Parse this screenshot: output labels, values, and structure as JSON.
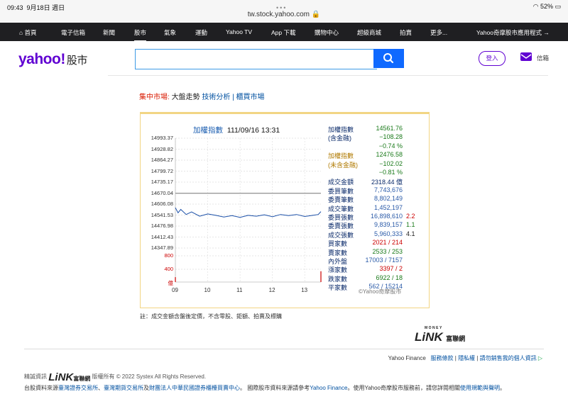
{
  "status_bar": {
    "time": "09:43",
    "date": "9月18日 週日",
    "url": "tw.stock.yahoo.com",
    "battery": "52%"
  },
  "top_nav": [
    "首頁",
    "電子信箱",
    "新聞",
    "股市",
    "氣象",
    "運動",
    "Yahoo TV",
    "App 下載",
    "購物中心",
    "超級商城",
    "拍賣",
    "更多..."
  ],
  "top_nav_app": "Yahoo奇摩股市應用程式",
  "header": {
    "logo": "yahoo!",
    "logo_suffix": "股市",
    "login": "登入",
    "mail": "信箱",
    "search_value": ""
  },
  "breadcrumb": {
    "label": "集中市場:",
    "current": "大盤走勢",
    "link1": "技術分析",
    "sep": "|",
    "link2": "櫃買市場"
  },
  "chart_data": {
    "type": "line",
    "title": "加權指數",
    "timestamp": "111/09/16 13:31",
    "y_ticks": [
      "14993.37",
      "14928.82",
      "14864.27",
      "14799.72",
      "14735.17",
      "14670.04",
      "14606.08",
      "14541.53",
      "14476.98",
      "14412.43",
      "14347.89"
    ],
    "volume_ticks": [
      "800",
      "400",
      "億"
    ],
    "x_ticks": [
      "09",
      "10",
      "11",
      "12",
      "13"
    ],
    "ylim": [
      14347.89,
      14993.37
    ],
    "reference_line": 14670.04,
    "series": [
      {
        "x": [
          "09:00",
          "09:05",
          "09:10",
          "09:20",
          "09:30",
          "09:45",
          "10:00",
          "10:15",
          "10:30",
          "10:45",
          "11:00",
          "11:15",
          "11:30",
          "11:45",
          "12:00",
          "12:15",
          "12:30",
          "12:45",
          "13:00",
          "13:15",
          "13:25",
          "13:30"
        ],
        "values": [
          14585,
          14555,
          14575,
          14545,
          14560,
          14535,
          14548,
          14540,
          14530,
          14538,
          14528,
          14540,
          14535,
          14543,
          14532,
          14545,
          14538,
          14545,
          14533,
          14540,
          14545,
          14562
        ]
      }
    ],
    "volume": {
      "x": [
        "09:00",
        "13:30"
      ],
      "values": [
        150,
        330
      ]
    }
  },
  "stats": [
    {
      "label": "加權指數",
      "value": "14561.76",
      "label_color": "#0a2a6a",
      "value_color": "#1a7a1a"
    },
    {
      "label": "(含金融)",
      "value": "−108.28",
      "label_color": "#0a2a6a",
      "value_color": "#1a7a1a"
    },
    {
      "label": "",
      "value": "−0.74 %",
      "label_color": "#0a2a6a",
      "value_color": "#1a7a1a"
    },
    {
      "label": "加權指數",
      "value": "12476.58",
      "label_color": "#b07a00",
      "value_color": "#1a7a1a"
    },
    {
      "label": "(未含金融)",
      "value": "−102.02",
      "label_color": "#b07a00",
      "value_color": "#1a7a1a"
    },
    {
      "label": "",
      "value": "−0.81 %",
      "label_color": "#b07a00",
      "value_color": "#1a7a1a"
    },
    {
      "label": "成交金額",
      "value": "2318.44 億",
      "label_color": "#0a2a6a",
      "value_color": "#0a2a6a"
    },
    {
      "label": "委買筆數",
      "value": "7,743,676",
      "label_color": "#0a2a6a",
      "value_color": "#2a5aa8"
    },
    {
      "label": "委賣筆數",
      "value": "8,802,149",
      "label_color": "#0a2a6a",
      "value_color": "#2a5aa8"
    },
    {
      "label": "成交筆數",
      "value": "1,452,197",
      "label_color": "#0a2a6a",
      "value_color": "#2a5aa8"
    },
    {
      "label": "委買張數",
      "value": "16,898,610",
      "extra": "2.2",
      "label_color": "#0a2a6a",
      "value_color": "#2a5aa8",
      "extra_color": "#c00"
    },
    {
      "label": "委賣張數",
      "value": "9,839,157",
      "extra": "1.1",
      "label_color": "#0a2a6a",
      "value_color": "#2a5aa8",
      "extra_color": "#1a7a1a"
    },
    {
      "label": "成交張數",
      "value": "5,960,333",
      "extra": "4.1",
      "label_color": "#0a2a6a",
      "value_color": "#2a5aa8",
      "extra_color": "#222"
    },
    {
      "label": "買家數",
      "value": "2021 / 214",
      "label_color": "#0a2a6a",
      "value_color": "#c00"
    },
    {
      "label": "賣家數",
      "value": "2533 / 253",
      "label_color": "#0a2a6a",
      "value_color": "#1a7a1a"
    },
    {
      "label": "內外盤",
      "value": "17003 / 7157",
      "label_color": "#0a2a6a",
      "value_color": "#2a5aa8"
    },
    {
      "label": "漲家數",
      "value": "3397 / 2",
      "label_color": "#0a2a6a",
      "value_color": "#c00"
    },
    {
      "label": "跌家數",
      "value": "6922 / 18",
      "label_color": "#0a2a6a",
      "value_color": "#1a7a1a"
    },
    {
      "label": "平家數",
      "value": "562 / 15214",
      "label_color": "#0a2a6a",
      "value_color": "#2a5aa8"
    }
  ],
  "chart_credit": "©Yahoo奇摩股市",
  "note": "註：成交金額含盤後定價，不含零股、鉅額、拍賣及標購",
  "brand": {
    "money": "MONEY",
    "link": "LiNK",
    "udn": "富聯網"
  },
  "footer": {
    "yahoo_finance": "Yahoo Finance",
    "links": [
      "服務條款",
      "隱私權",
      "請勿銷售我的個人資訊"
    ],
    "sep": "|",
    "data_source_prefix": "精誠資訊",
    "rights": "版權所有 © 2022 Systex All Rights Reserved.",
    "source_line": {
      "t1": "台股資料來源",
      "l1": "臺灣證券交易所",
      "t2": "、",
      "l2": "臺灣期貨交易所",
      "t3": "及",
      "l3": "財團法人中華民國證券櫃檯買賣中心",
      "t4": "。 國際股市資料來源請參考",
      "l4": "Yahoo Finance",
      "t5": "。使用Yahoo奇摩股市服務前，請您詳閱相關",
      "l5": "使用規範與聲明",
      "t6": "。"
    }
  },
  "colors": {
    "accent": "#6001d2",
    "nav_bg": "#1f1f22",
    "search_btn": "#0f69ff",
    "line": "#1a4fa8",
    "ref_line": "#999999",
    "up": "#cc0000",
    "down": "#1a7a1a"
  }
}
